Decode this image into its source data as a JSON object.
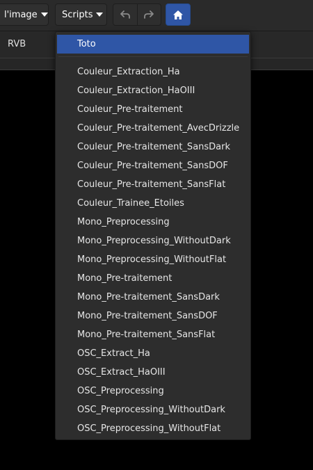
{
  "toolbar": {
    "image_menu_label": "l'image",
    "scripts_menu_label": "Scripts",
    "undo_icon": "undo-icon",
    "redo_icon": "redo-icon",
    "home_icon": "home-icon",
    "accent_color": "#2f56a6"
  },
  "view": {
    "mode_label": "RVB"
  },
  "scripts_menu": {
    "highlighted_item": "Toto",
    "items": [
      "Couleur_Extraction_Ha",
      "Couleur_Extraction_HaOIII",
      "Couleur_Pre-traitement",
      "Couleur_Pre-traitement_AvecDrizzle",
      "Couleur_Pre-traitement_SansDark",
      "Couleur_Pre-traitement_SansDOF",
      "Couleur_Pre-traitement_SansFlat",
      "Couleur_Trainee_Etoiles",
      "Mono_Preprocessing",
      "Mono_Preprocessing_WithoutDark",
      "Mono_Preprocessing_WithoutFlat",
      "Mono_Pre-traitement",
      "Mono_Pre-traitement_SansDark",
      "Mono_Pre-traitement_SansDOF",
      "Mono_Pre-traitement_SansFlat",
      "OSC_Extract_Ha",
      "OSC_Extract_HaOIII",
      "OSC_Preprocessing",
      "OSC_Preprocessing_WithoutDark",
      "OSC_Preprocessing_WithoutFlat"
    ]
  }
}
